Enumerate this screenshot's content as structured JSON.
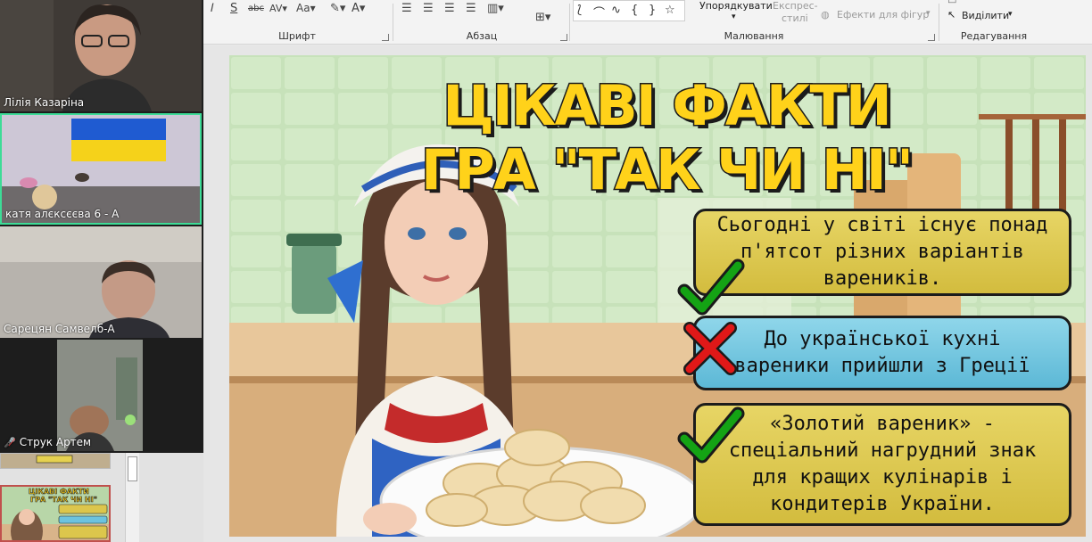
{
  "ribbon": {
    "font_group": "Шрифт",
    "paragraph_group": "Абзац",
    "drawing_group": "Малювання",
    "editing_group": "Редагування",
    "arrange_label": "Упорядкувати",
    "quick_styles_line1": "Експрес-",
    "quick_styles_line2": "стилі",
    "shape_effects_label": "Ефекти для фігур",
    "select_label": "Виділити"
  },
  "participants": [
    {
      "name": "Лілія Казаріна"
    },
    {
      "name": "катя алєксєєва 6 - А"
    },
    {
      "name": "Сарецян Самвелб-А"
    },
    {
      "name": "Струк Артем"
    }
  ],
  "slide": {
    "title_line1": "ЦІКАВІ ФАКТИ",
    "title_line2": "ГРА \"ТАК ЧИ НІ\"",
    "facts": [
      {
        "lines": [
          "Сьогодні у світі існує понад",
          "п'ятсот різних варіантів",
          "вареників."
        ],
        "answer": "yes"
      },
      {
        "lines": [
          "До української кухні",
          "вареники прийшли з Греції"
        ],
        "answer": "no"
      },
      {
        "lines": [
          "«Золотий вареник» -",
          "спеціальний нагрудний знак",
          "для кращих кулінарів і",
          "кондитерів України."
        ],
        "answer": "yes"
      }
    ]
  },
  "thumbnail": {
    "title_line1": "ЦІКАВІ ФАКТИ",
    "title_line2": "ГРА \"ТАК ЧИ НІ\""
  },
  "colors": {
    "title_fill": "#ffd21a",
    "fact_yellow": "#dcc64c",
    "fact_blue": "#6cc3df",
    "check_green": "#14a314",
    "cross_red": "#e01818",
    "active_speaker": "#3ddc97"
  }
}
